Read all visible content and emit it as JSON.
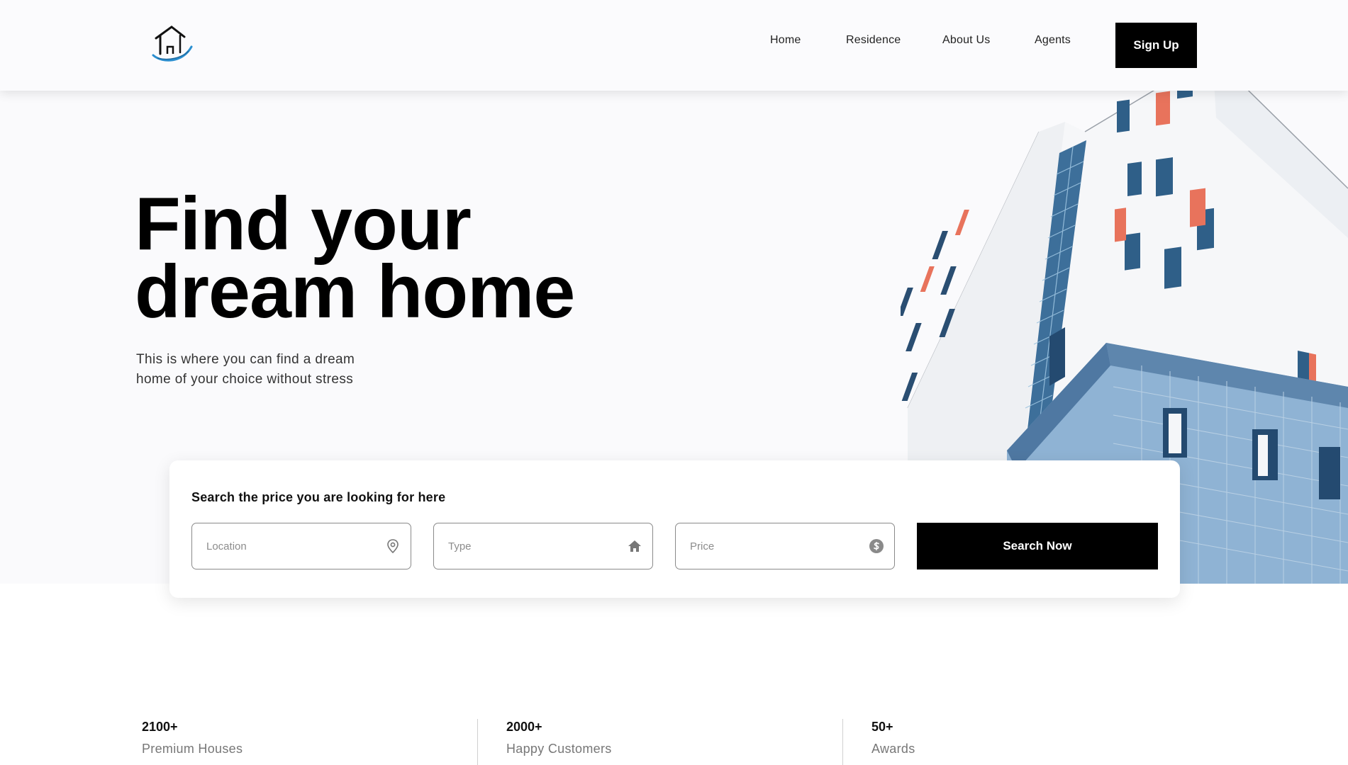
{
  "header": {
    "logo_icon": "house-logo-icon",
    "nav": {
      "home": "Home",
      "residence": "Residence",
      "about": "About Us",
      "agents": "Agents"
    },
    "signup_label": "Sign Up"
  },
  "hero": {
    "headline_line1": "Find your",
    "headline_line2": "dream home",
    "subtext": "This is where you can find a dream home of your choice without stress"
  },
  "search": {
    "title": "Search the price you are looking for here",
    "location_placeholder": "Location",
    "type_placeholder": "Type",
    "price_placeholder": "Price",
    "button_label": "Search Now",
    "icons": [
      "location-pin-icon",
      "home-icon",
      "dollar-icon"
    ]
  },
  "stats": [
    {
      "value": "2100+",
      "label": "Premium Houses"
    },
    {
      "value": "2000+",
      "label": "Happy Customers"
    },
    {
      "value": "50+",
      "label": "Awards"
    }
  ],
  "colors": {
    "accent": "#000000",
    "hero_bg": "#fafafc",
    "logo_blue": "#2b8fd0"
  }
}
